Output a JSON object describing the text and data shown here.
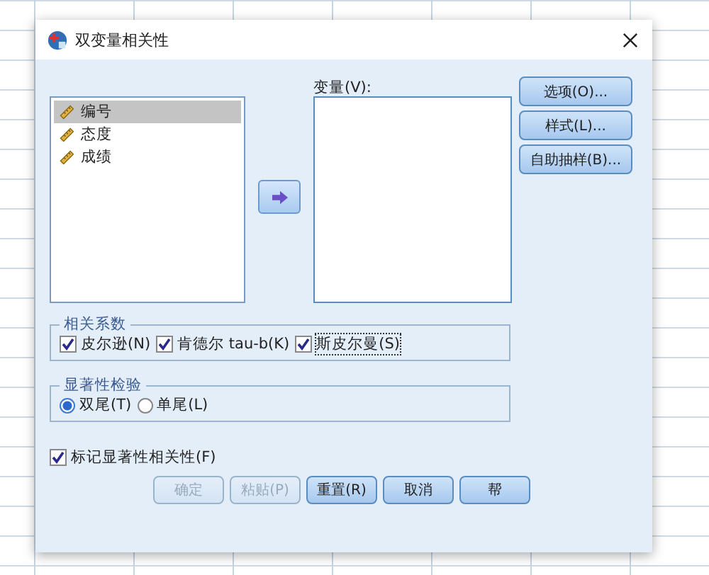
{
  "window": {
    "title": "双变量相关性"
  },
  "source_list": {
    "items": [
      {
        "label": "编号",
        "selected": true
      },
      {
        "label": "态度",
        "selected": false
      },
      {
        "label": "成绩",
        "selected": false
      }
    ]
  },
  "target_list": {
    "label": "变量(V):"
  },
  "side_buttons": [
    "选项(O)...",
    "样式(L)...",
    "自助抽样(B)..."
  ],
  "correlation_coefficients": {
    "title": "相关系数",
    "options": [
      {
        "label": "皮尔逊(N)",
        "checked": true,
        "focused": false
      },
      {
        "label": "肯德尔 tau-b(K)",
        "checked": true,
        "focused": false
      },
      {
        "label": "斯皮尔曼(S)",
        "checked": true,
        "focused": true
      }
    ]
  },
  "significance_test": {
    "title": "显著性检验",
    "options": [
      {
        "label": "双尾(T)",
        "selected": true
      },
      {
        "label": "单尾(L)",
        "selected": false
      }
    ]
  },
  "flag_significant": {
    "label": "标记显著性相关性(F)",
    "checked": true
  },
  "buttons": [
    {
      "label": "确定",
      "disabled": true
    },
    {
      "label": "粘贴(P)",
      "disabled": true
    },
    {
      "label": "重置(R)",
      "disabled": false
    },
    {
      "label": "取消",
      "disabled": false
    },
    {
      "label": "帮",
      "disabled": false
    }
  ]
}
